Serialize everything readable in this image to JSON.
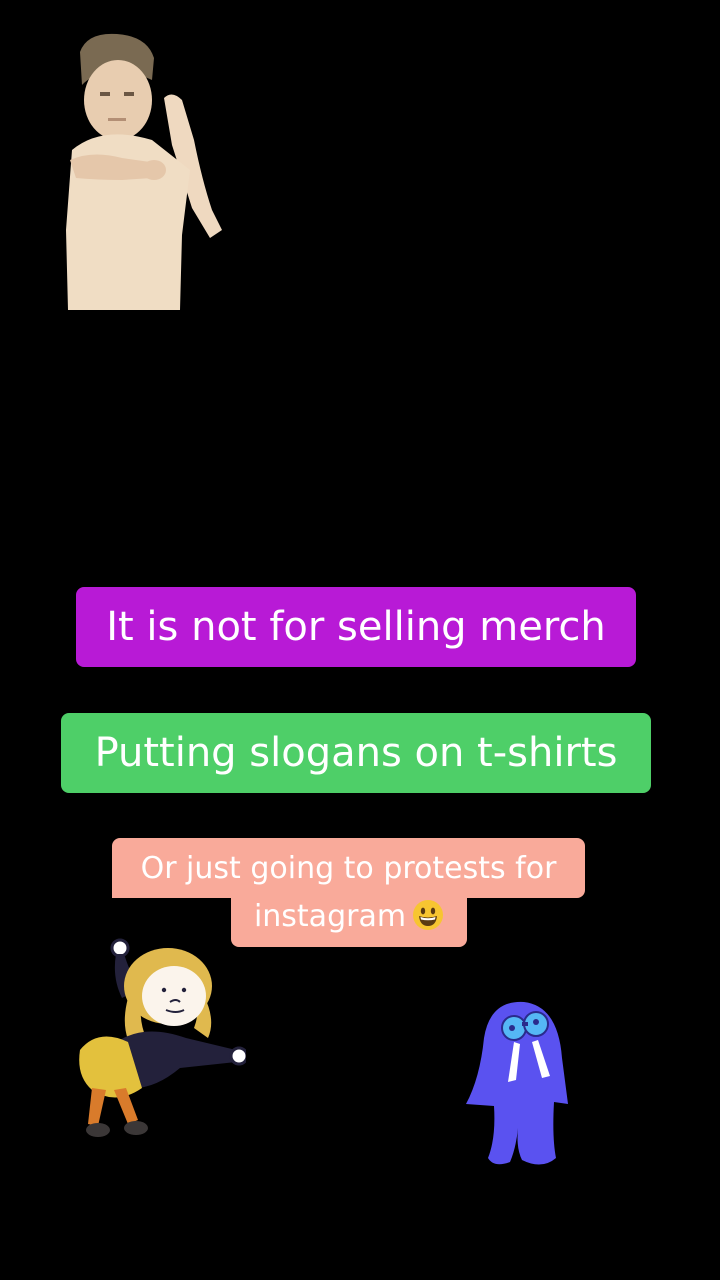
{
  "captions": {
    "line1": "It is not for selling merch",
    "line2": "Putting slogans on t-shirts",
    "line3a": "Or just going to protests for",
    "line3b": "instagram"
  },
  "icons": {
    "emoji": "grinning-face-emoji",
    "sticker_top": "dancing-boy-sticker",
    "sticker_bottom_left": "dancing-girl-sticker",
    "sticker_bottom_right": "blue-walrus-sticker"
  },
  "colors": {
    "background": "#000000",
    "purple_pill": "#b81ad6",
    "green_pill": "#4ecf68",
    "pink_pill": "#f9aa9a",
    "walrus": "#5a52f0"
  }
}
